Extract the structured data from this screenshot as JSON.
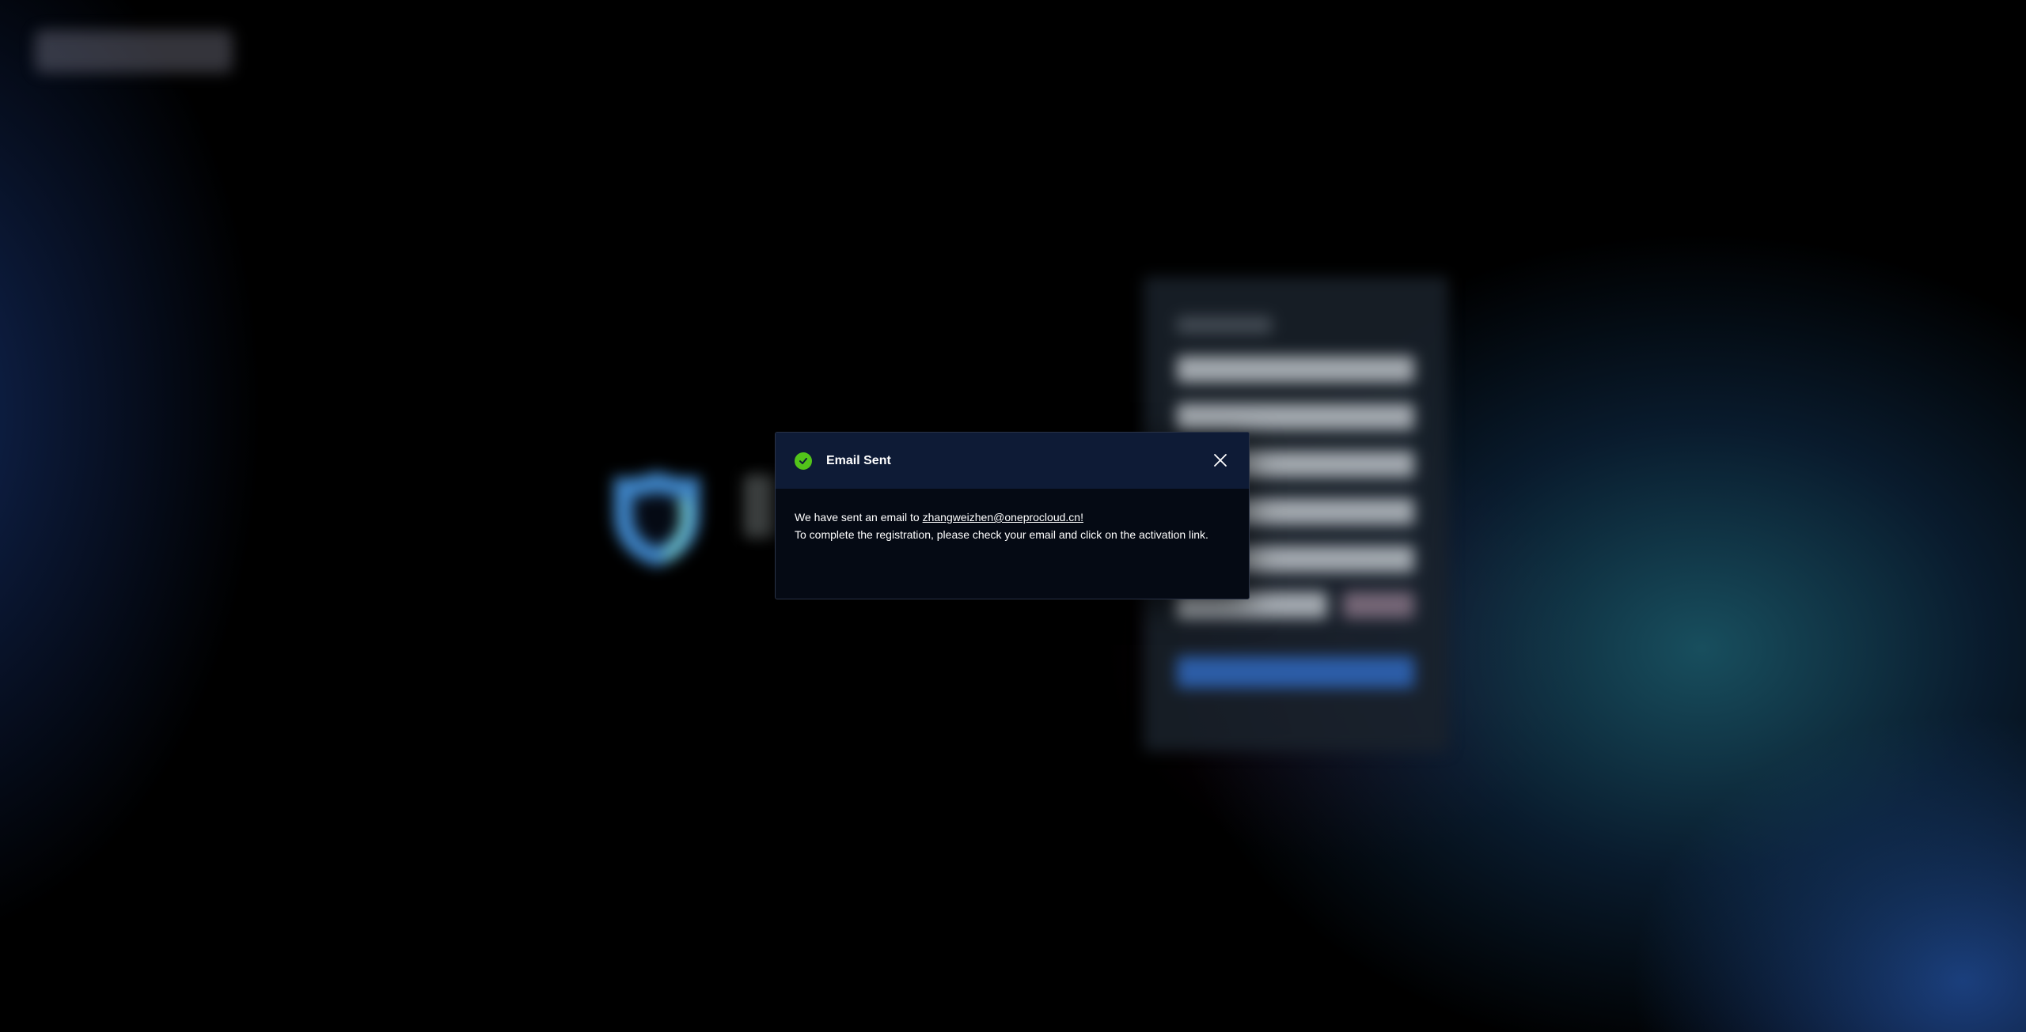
{
  "modal": {
    "title": "Email Sent",
    "message_prefix": "We have sent an email to ",
    "email": "zhangweizhen@oneprocloud.cn!",
    "message_line2": "To complete the registration, please check your email and click on the activation link.",
    "icon": "check-circle-icon",
    "close_icon": "close-icon"
  },
  "colors": {
    "success": "#52c41a",
    "header_bg": "#0e1b36",
    "body_bg": "#050a14",
    "text": "#ffffff"
  }
}
